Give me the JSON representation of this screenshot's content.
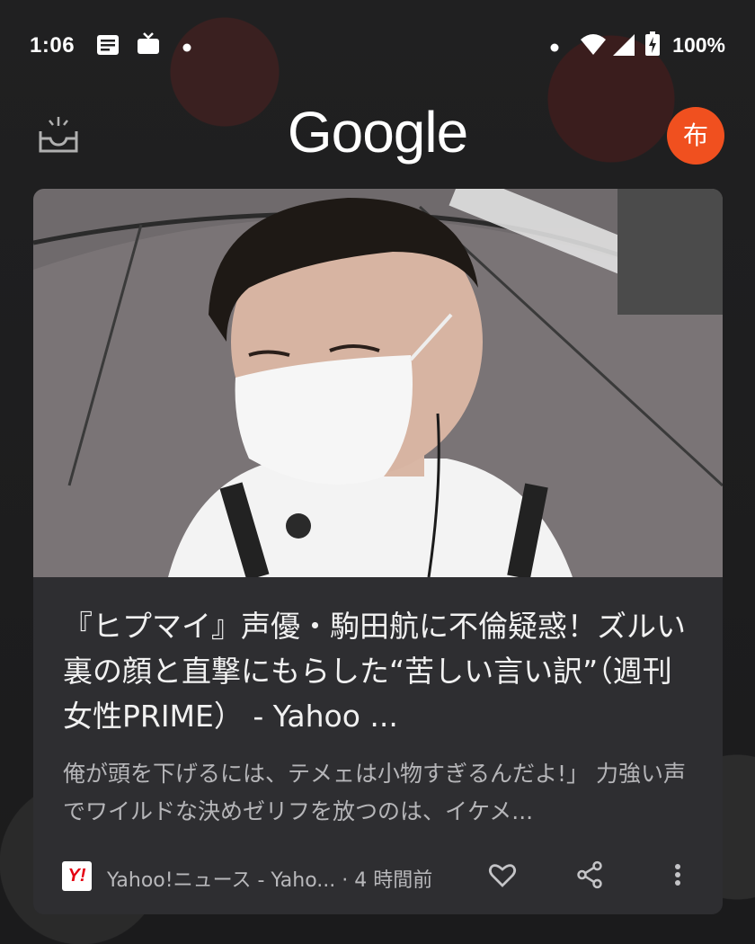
{
  "status_bar": {
    "time": "1:06",
    "battery": "100%",
    "icons": [
      "notes-icon",
      "tv-icon",
      "dot-icon",
      "dot-icon",
      "wifi-icon",
      "signal-icon",
      "battery-charging-icon"
    ]
  },
  "header": {
    "logo": "Google",
    "avatar_initial": "布",
    "avatar_color": "#f0501f"
  },
  "article": {
    "image_description": "news-photo",
    "headline": "『ヒプマイ』声優・駒田航に不倫疑惑！ズルい裏の顔と直撃にもらした“苦しい言い訳”（週刊女性PRIME） - Yahoo ...",
    "snippet": "俺が頭を下げるには、テメェは小物すぎるんだよ!」 力強い声でワイルドな決めゼリフを放つのは、イケメ...",
    "source_logo_text": "Y!",
    "source_text": "Yahoo!ニュース - Yaho... · 4 時間前",
    "actions": [
      "heart-icon",
      "share-icon",
      "more-vert-icon"
    ]
  }
}
